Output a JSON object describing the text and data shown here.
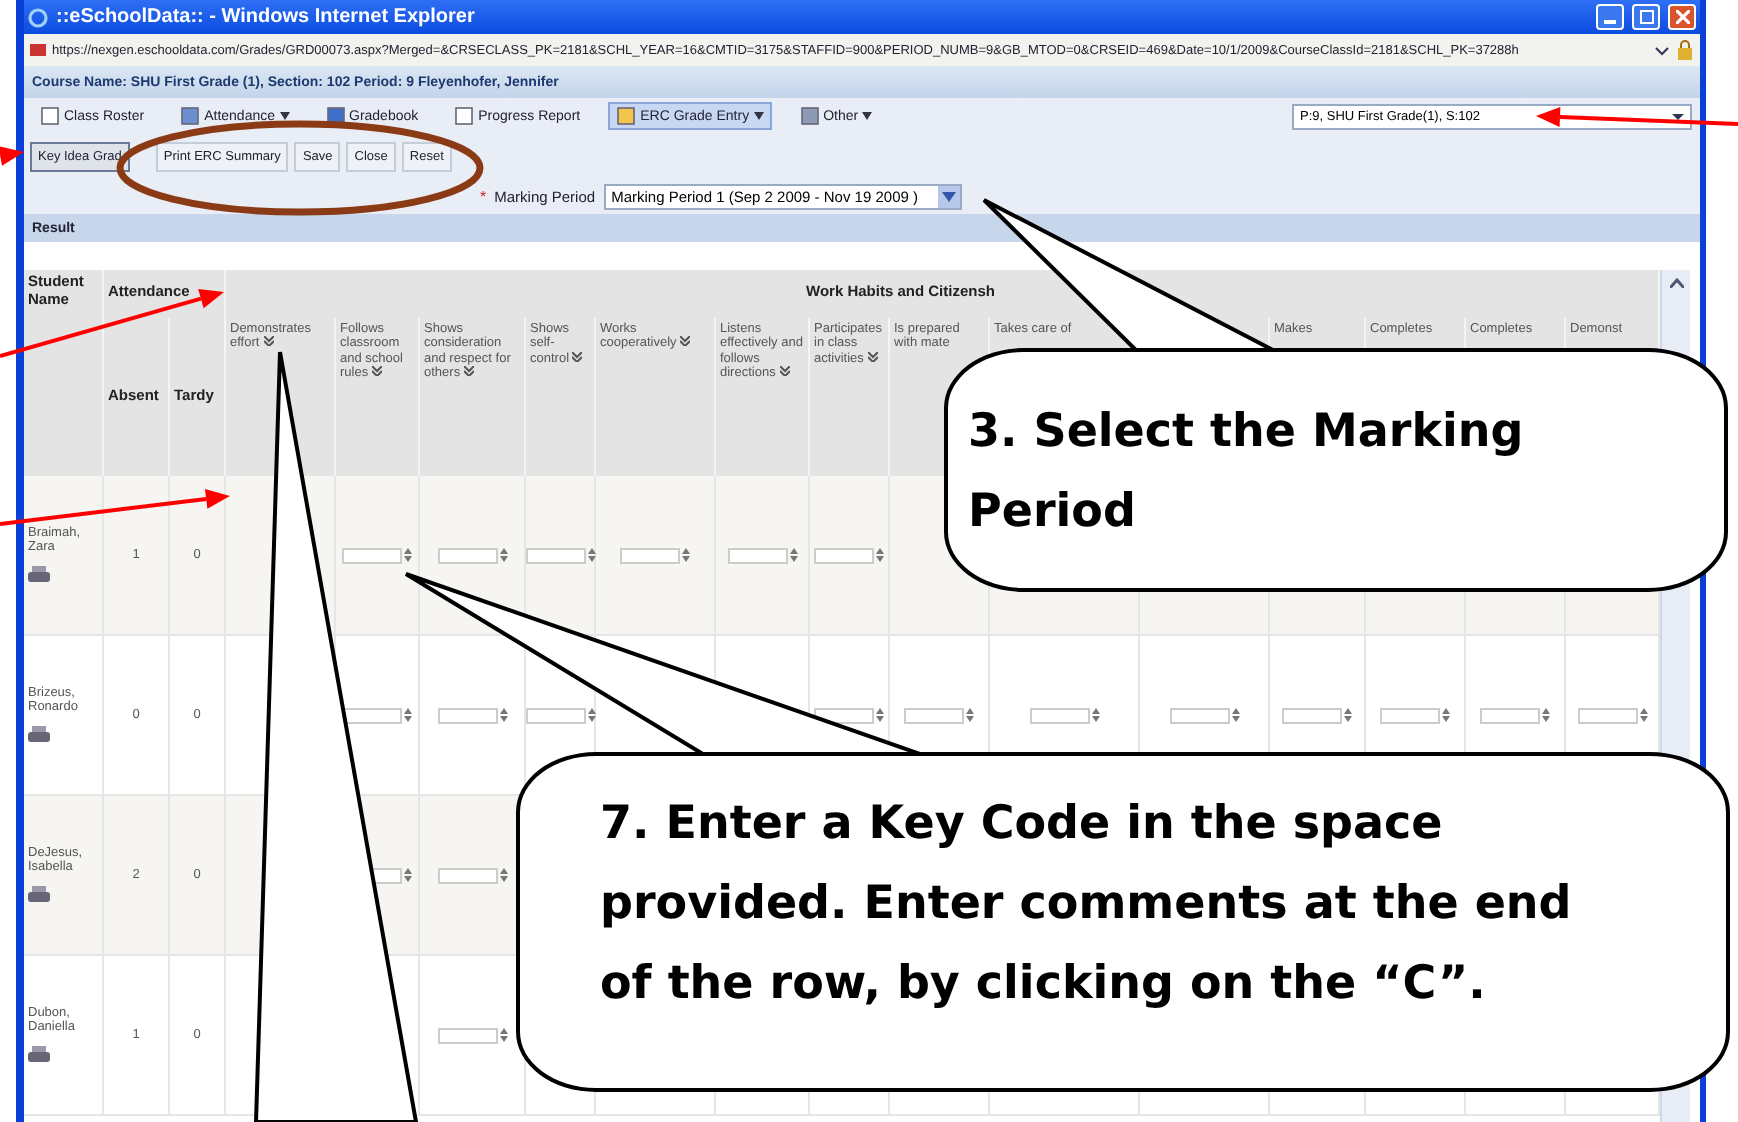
{
  "window": {
    "title": "::eSchoolData:: - Windows Internet Explorer",
    "url": "https://nexgen.eschooldata.com/Grades/GRD00073.aspx?Merged=&CRSECLASS_PK=2181&SCHL_YEAR=16&CMTID=3175&STAFFID=900&PERIOD_NUMB=9&GB_MTOD=0&CRSEID=469&Date=10/1/2009&CourseClassId=2181&SCHL_PK=37288h"
  },
  "course_name": "Course Name: SHU First Grade (1), Section: 102 Period: 9 Fleyenhofer, Jennifer",
  "nav_toolbar": [
    {
      "label": "Class Roster",
      "kind": "page",
      "menu": false,
      "selected": false
    },
    {
      "label": "Attendance",
      "kind": "calendar",
      "menu": true,
      "selected": false
    },
    {
      "label": "Gradebook",
      "kind": "book",
      "menu": false,
      "selected": false
    },
    {
      "label": "Progress Report",
      "kind": "page",
      "menu": false,
      "selected": false
    },
    {
      "label": "ERC Grade Entry",
      "kind": "folder",
      "menu": true,
      "selected": true
    },
    {
      "label": "Other",
      "kind": "clipboard",
      "menu": true,
      "selected": false
    }
  ],
  "class_select": {
    "value": "P:9, SHU First Grade(1), S:102"
  },
  "action_buttons": [
    {
      "label": "Key Idea Grad",
      "selected": true
    },
    {
      "label": "Print ERC Summary",
      "selected": false
    },
    {
      "label": "Save",
      "selected": false
    },
    {
      "label": "Close",
      "selected": false
    },
    {
      "label": "Reset",
      "selected": false
    }
  ],
  "marking_period": {
    "required": "*",
    "label": "Marking Period",
    "value": "Marking Period 1 (Sep 2 2009 - Nov 19 2009 )"
  },
  "result_header": "Result",
  "table": {
    "student_header": "Student Name",
    "groups": [
      "Attendance",
      "Work Habits and Citizensh"
    ],
    "attendance_columns": [
      "Absent",
      "Tardy"
    ],
    "columns": [
      {
        "label": "Demonstrates effort"
      },
      {
        "label": "Follows classroom and school rules"
      },
      {
        "label": "Shows consideration and respect for others"
      },
      {
        "label": "Shows self-control"
      },
      {
        "label": "Works cooperatively"
      },
      {
        "label": "Listens effectively and follows directions"
      },
      {
        "label": "Participates in class activities"
      },
      {
        "label": "Is prepared with mate"
      },
      {
        "label": "Takes care of"
      },
      {},
      {
        "label": "Makes"
      },
      {
        "label": "Completes"
      },
      {
        "label": "Completes"
      },
      {
        "label": "Demonst"
      }
    ],
    "rows": [
      {
        "name": "Braimah, Zara",
        "absent": "1",
        "tardy": "0",
        "shaded": true
      },
      {
        "name": "Brizeus, Ronardo",
        "absent": "0",
        "tardy": "0",
        "shaded": false
      },
      {
        "name": "DeJesus, Isabella",
        "absent": "2",
        "tardy": "0",
        "shaded": true
      },
      {
        "name": "Dubon, Daniella",
        "absent": "1",
        "tardy": "0",
        "shaded": false
      }
    ]
  },
  "callouts": [
    {
      "text": "3. Select the Marking Period"
    },
    {
      "text": "7. Enter a Key Code in the space provided. Enter comments at the end of the row, by clicking on the “C”."
    }
  ]
}
